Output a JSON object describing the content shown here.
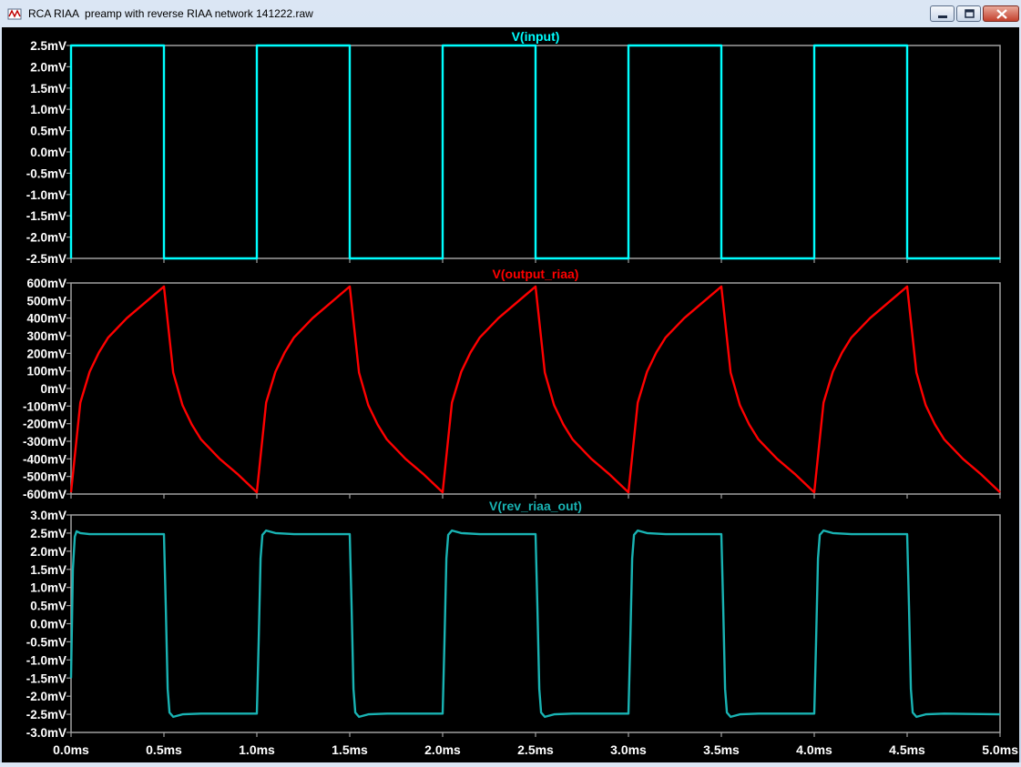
{
  "window": {
    "title": "RCA RIAA  preamp with reverse RIAA network 141222.raw",
    "icon": "ltspice-waveform-icon",
    "buttons": [
      "minimize",
      "maximize",
      "close"
    ]
  },
  "colors": {
    "background": "#000000",
    "grid_frame": "#a0a0a0",
    "axis_text": "#ffffff",
    "input_trace": "#00ffff",
    "output_riaa_trace": "#ff0000",
    "rev_riaa_trace": "#19b3b3"
  },
  "chart_data": [
    {
      "type": "line",
      "title": "V(input)",
      "x_ticks": [
        "0.0ms",
        "0.5ms",
        "1.0ms",
        "1.5ms",
        "2.0ms",
        "2.5ms",
        "3.0ms",
        "3.5ms",
        "4.0ms",
        "4.5ms",
        "5.0ms"
      ],
      "xlim": [
        0,
        5
      ],
      "ylim": [
        -2.5,
        2.5
      ],
      "y_ticks": [
        "2.5mV",
        "2.0mV",
        "1.5mV",
        "1.0mV",
        "0.5mV",
        "0.0mV",
        "-0.5mV",
        "-1.0mV",
        "-1.5mV",
        "-2.0mV",
        "-2.5mV"
      ],
      "y_tick_values": [
        2.5,
        2.0,
        1.5,
        1.0,
        0.5,
        0.0,
        -0.5,
        -1.0,
        -1.5,
        -2.0,
        -2.5
      ],
      "series": [
        {
          "name": "V(input)",
          "color": "#00ffff",
          "x": [
            0,
            0,
            0.5,
            0.5,
            1.0,
            1.0,
            1.5,
            1.5,
            2.0,
            2.0,
            2.5,
            2.5,
            3.0,
            3.0,
            3.5,
            3.5,
            4.0,
            4.0,
            4.5,
            4.5,
            5.0
          ],
          "y": [
            -2.5,
            2.5,
            2.5,
            -2.5,
            -2.5,
            2.5,
            2.5,
            -2.5,
            -2.5,
            2.5,
            2.5,
            -2.5,
            -2.5,
            2.5,
            2.5,
            -2.5,
            -2.5,
            2.5,
            2.5,
            -2.5,
            -2.5
          ]
        }
      ]
    },
    {
      "type": "line",
      "title": "V(output_riaa)",
      "x_ticks": [
        "0.0ms",
        "0.5ms",
        "1.0ms",
        "1.5ms",
        "2.0ms",
        "2.5ms",
        "3.0ms",
        "3.5ms",
        "4.0ms",
        "4.5ms",
        "5.0ms"
      ],
      "xlim": [
        0,
        5
      ],
      "ylim": [
        -600,
        600
      ],
      "y_ticks": [
        "600mV",
        "500mV",
        "400mV",
        "300mV",
        "200mV",
        "100mV",
        "0mV",
        "-100mV",
        "-200mV",
        "-300mV",
        "-400mV",
        "-500mV",
        "-600mV"
      ],
      "y_tick_values": [
        600,
        500,
        400,
        300,
        200,
        100,
        0,
        -100,
        -200,
        -300,
        -400,
        -500,
        -600
      ],
      "series": [
        {
          "name": "V(output_riaa)",
          "color": "#ff0000",
          "x": [
            0,
            0.05,
            0.1,
            0.15,
            0.2,
            0.3,
            0.4,
            0.5,
            0.55,
            0.6,
            0.65,
            0.7,
            0.8,
            0.9,
            1.0,
            1.05,
            1.1,
            1.15,
            1.2,
            1.3,
            1.4,
            1.5,
            1.55,
            1.6,
            1.65,
            1.7,
            1.8,
            1.9,
            2.0,
            2.05,
            2.1,
            2.15,
            2.2,
            2.3,
            2.4,
            2.5,
            2.55,
            2.6,
            2.65,
            2.7,
            2.8,
            2.9,
            3.0,
            3.05,
            3.1,
            3.15,
            3.2,
            3.3,
            3.4,
            3.5,
            3.55,
            3.6,
            3.65,
            3.7,
            3.8,
            3.9,
            4.0,
            4.05,
            4.1,
            4.15,
            4.2,
            4.3,
            4.4,
            4.5,
            4.55,
            4.6,
            4.65,
            4.7,
            4.8,
            4.9,
            5.0
          ],
          "y": [
            -590,
            -80,
            95,
            205,
            290,
            400,
            490,
            580,
            90,
            -95,
            -205,
            -290,
            -400,
            -490,
            -590,
            -80,
            95,
            205,
            290,
            400,
            490,
            580,
            90,
            -95,
            -205,
            -290,
            -400,
            -490,
            -590,
            -80,
            95,
            205,
            290,
            400,
            490,
            580,
            90,
            -95,
            -205,
            -290,
            -400,
            -490,
            -590,
            -80,
            95,
            205,
            290,
            400,
            490,
            580,
            90,
            -95,
            -205,
            -290,
            -400,
            -490,
            -590,
            -80,
            95,
            205,
            290,
            400,
            490,
            580,
            90,
            -95,
            -205,
            -290,
            -400,
            -490,
            -590
          ]
        }
      ]
    },
    {
      "type": "line",
      "title": "V(rev_riaa_out)",
      "x_ticks": [
        "0.0ms",
        "0.5ms",
        "1.0ms",
        "1.5ms",
        "2.0ms",
        "2.5ms",
        "3.0ms",
        "3.5ms",
        "4.0ms",
        "4.5ms",
        "5.0ms"
      ],
      "xlim": [
        0,
        5
      ],
      "ylim": [
        -3.0,
        3.0
      ],
      "y_ticks": [
        "3.0mV",
        "2.5mV",
        "2.0mV",
        "1.5mV",
        "1.0mV",
        "0.5mV",
        "0.0mV",
        "-0.5mV",
        "-1.0mV",
        "-1.5mV",
        "-2.0mV",
        "-2.5mV",
        "-3.0mV"
      ],
      "y_tick_values": [
        3.0,
        2.5,
        2.0,
        1.5,
        1.0,
        0.5,
        0.0,
        -0.5,
        -1.0,
        -1.5,
        -2.0,
        -2.5,
        -3.0
      ],
      "series": [
        {
          "name": "V(rev_riaa_out)",
          "color": "#19b3b3",
          "x": [
            0,
            0.01,
            0.02,
            0.03,
            0.05,
            0.1,
            0.2,
            0.5,
            0.51,
            0.52,
            0.53,
            0.55,
            0.6,
            0.7,
            1.0,
            1.01,
            1.02,
            1.03,
            1.05,
            1.1,
            1.2,
            1.5,
            1.51,
            1.52,
            1.53,
            1.55,
            1.6,
            1.7,
            2.0,
            2.01,
            2.02,
            2.03,
            2.05,
            2.1,
            2.2,
            2.5,
            2.51,
            2.52,
            2.53,
            2.55,
            2.6,
            2.7,
            3.0,
            3.01,
            3.02,
            3.03,
            3.05,
            3.1,
            3.2,
            3.5,
            3.51,
            3.52,
            3.53,
            3.55,
            3.6,
            3.7,
            4.0,
            4.01,
            4.02,
            4.03,
            4.05,
            4.1,
            4.2,
            4.5,
            4.51,
            4.52,
            4.53,
            4.55,
            4.6,
            4.7,
            5.0
          ],
          "y": [
            -1.5,
            1.5,
            2.4,
            2.55,
            2.5,
            2.47,
            2.47,
            2.47,
            0.5,
            -1.8,
            -2.45,
            -2.57,
            -2.5,
            -2.48,
            -2.48,
            -0.5,
            1.8,
            2.45,
            2.57,
            2.5,
            2.47,
            2.47,
            0.5,
            -1.8,
            -2.45,
            -2.57,
            -2.5,
            -2.48,
            -2.48,
            -0.5,
            1.8,
            2.45,
            2.57,
            2.5,
            2.47,
            2.47,
            0.5,
            -1.8,
            -2.45,
            -2.57,
            -2.5,
            -2.48,
            -2.48,
            -0.5,
            1.8,
            2.45,
            2.57,
            2.5,
            2.47,
            2.47,
            0.5,
            -1.8,
            -2.45,
            -2.57,
            -2.5,
            -2.48,
            -2.48,
            -0.5,
            1.8,
            2.45,
            2.57,
            2.5,
            2.47,
            2.47,
            0.5,
            -1.8,
            -2.45,
            -2.57,
            -2.5,
            -2.48,
            -2.5
          ]
        }
      ]
    }
  ]
}
